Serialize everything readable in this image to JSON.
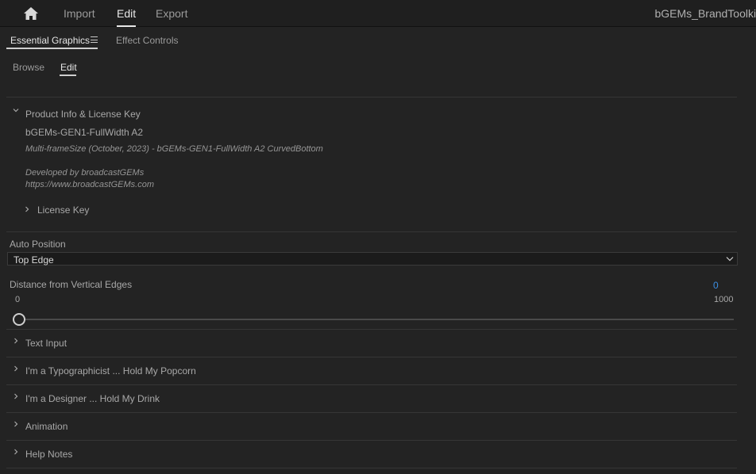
{
  "topbar": {
    "nav": [
      "Import",
      "Edit",
      "Export"
    ],
    "active_nav": "Edit",
    "project_title": "bGEMs_BrandToolkit"
  },
  "panel": {
    "tabs": [
      "Essential Graphics",
      "Effect Controls"
    ],
    "active_tab": "Essential Graphics",
    "subtabs": [
      "Browse",
      "Edit"
    ],
    "active_subtab": "Edit"
  },
  "product_info": {
    "header": "Product Info & License Key",
    "expanded": true,
    "name": "bGEMs-GEN1-FullWidth A2",
    "description": "Multi-frameSize (October, 2023) - bGEMs-GEN1-FullWidth A2 CurvedBottom",
    "developer": "Developed by broadcastGEMs",
    "url": "https://www.broadcastGEMs.com",
    "license_key_label": "License Key"
  },
  "auto_position": {
    "label": "Auto Position",
    "value": "Top Edge"
  },
  "distance_slider": {
    "label": "Distance from Vertical Edges",
    "value": "0",
    "min": "0",
    "max": "1000",
    "fraction": 0
  },
  "sections": [
    "Text Input",
    "I'm a Typographicist ... Hold My Popcorn",
    "I'm a Designer ... Hold My Drink",
    "Animation",
    "Help Notes"
  ],
  "colors": {
    "background": "#232323",
    "accent_value": "#3b8ee3"
  }
}
